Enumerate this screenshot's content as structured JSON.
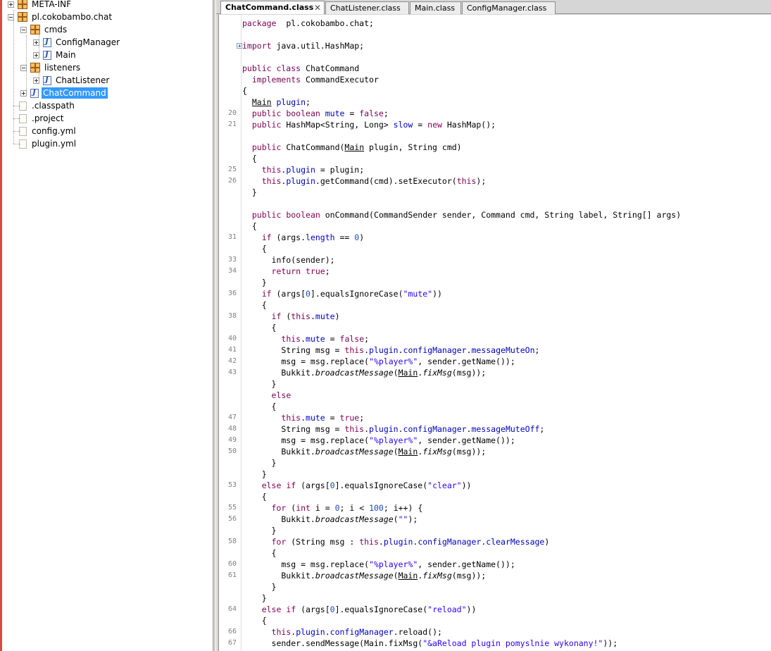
{
  "tree": {
    "items": [
      {
        "label": "META-INF",
        "icon": "package-icon",
        "depth": 0,
        "expander": "plus"
      },
      {
        "label": "pl.cokobambo.chat",
        "icon": "package-icon",
        "depth": 0,
        "expander": "minus"
      },
      {
        "label": "cmds",
        "icon": "package-icon",
        "depth": 1,
        "expander": "minus"
      },
      {
        "label": "ConfigManager",
        "icon": "class-icon",
        "depth": 2,
        "expander": "plus"
      },
      {
        "label": "Main",
        "icon": "class-icon",
        "depth": 2,
        "expander": "plus"
      },
      {
        "label": "listeners",
        "icon": "package-icon",
        "depth": 1,
        "expander": "minus"
      },
      {
        "label": "ChatListener",
        "icon": "class-icon",
        "depth": 2,
        "expander": "plus"
      },
      {
        "label": "ChatCommand",
        "icon": "class-icon",
        "depth": 1,
        "expander": "plus",
        "selected": true
      },
      {
        "label": ".classpath",
        "icon": "file-icon",
        "depth": 0,
        "expander": "none"
      },
      {
        "label": ".project",
        "icon": "file-icon",
        "depth": 0,
        "expander": "none"
      },
      {
        "label": "config.yml",
        "icon": "file-icon",
        "depth": 0,
        "expander": "none"
      },
      {
        "label": "plugin.yml",
        "icon": "file-icon",
        "depth": 0,
        "expander": "none"
      }
    ]
  },
  "tabs": [
    {
      "label": "ChatCommand.class",
      "active": true,
      "close": "✕"
    },
    {
      "label": "ChatListener.class",
      "active": false
    },
    {
      "label": "Main.class",
      "active": false
    },
    {
      "label": "ConfigManager.class",
      "active": false
    }
  ],
  "code": [
    {
      "ln": "",
      "tokens": [
        [
          "kw",
          "package"
        ],
        [
          "",
          "  pl.cokobambo.chat;"
        ]
      ]
    },
    {
      "ln": "",
      "tokens": []
    },
    {
      "ln": "",
      "fold": true,
      "tokens": [
        [
          "kw",
          "import"
        ],
        [
          "",
          " java.util.HashMap;"
        ]
      ]
    },
    {
      "ln": "",
      "tokens": []
    },
    {
      "ln": "",
      "tokens": [
        [
          "kw",
          "public class"
        ],
        [
          "",
          " ChatCommand"
        ]
      ]
    },
    {
      "ln": "",
      "tokens": [
        [
          "",
          "  "
        ],
        [
          "kw",
          "implements"
        ],
        [
          "",
          " CommandExecutor"
        ]
      ]
    },
    {
      "ln": "",
      "tokens": [
        [
          "",
          "{"
        ]
      ]
    },
    {
      "ln": "",
      "tokens": [
        [
          "",
          "  "
        ],
        [
          "und",
          "Main"
        ],
        [
          "",
          " "
        ],
        [
          "fld",
          "plugin"
        ],
        [
          "",
          ";"
        ]
      ]
    },
    {
      "ln": "20",
      "tokens": [
        [
          "",
          "  "
        ],
        [
          "kw",
          "public boolean"
        ],
        [
          "",
          " "
        ],
        [
          "fld",
          "mute"
        ],
        [
          "",
          " = "
        ],
        [
          "kw",
          "false"
        ],
        [
          "",
          ";"
        ]
      ]
    },
    {
      "ln": "21",
      "tokens": [
        [
          "",
          "  "
        ],
        [
          "kw",
          "public"
        ],
        [
          "",
          " HashMap<String, Long> "
        ],
        [
          "fld",
          "slow"
        ],
        [
          "",
          " = "
        ],
        [
          "kw",
          "new"
        ],
        [
          "",
          " HashMap();"
        ]
      ]
    },
    {
      "ln": "",
      "tokens": []
    },
    {
      "ln": "",
      "tokens": [
        [
          "",
          "  "
        ],
        [
          "kw",
          "public"
        ],
        [
          "",
          " ChatCommand("
        ],
        [
          "und",
          "Main"
        ],
        [
          "",
          " plugin, String cmd)"
        ]
      ]
    },
    {
      "ln": "",
      "tokens": [
        [
          "",
          "  {"
        ]
      ]
    },
    {
      "ln": "25",
      "tokens": [
        [
          "",
          "    "
        ],
        [
          "kw",
          "this"
        ],
        [
          "",
          "."
        ],
        [
          "fld",
          "plugin"
        ],
        [
          "",
          " = plugin;"
        ]
      ]
    },
    {
      "ln": "26",
      "tokens": [
        [
          "",
          "    "
        ],
        [
          "kw",
          "this"
        ],
        [
          "",
          "."
        ],
        [
          "fld",
          "plugin"
        ],
        [
          "",
          ".getCommand(cmd).setExecutor("
        ],
        [
          "kw",
          "this"
        ],
        [
          "",
          ");"
        ]
      ]
    },
    {
      "ln": "",
      "tokens": [
        [
          "",
          "  }"
        ]
      ]
    },
    {
      "ln": "",
      "tokens": []
    },
    {
      "ln": "",
      "tokens": [
        [
          "",
          "  "
        ],
        [
          "kw",
          "public boolean"
        ],
        [
          "",
          " onCommand(CommandSender sender, Command cmd, String label, String[] args)"
        ]
      ]
    },
    {
      "ln": "",
      "tokens": [
        [
          "",
          "  {"
        ]
      ]
    },
    {
      "ln": "31",
      "tokens": [
        [
          "",
          "    "
        ],
        [
          "kw",
          "if"
        ],
        [
          "",
          " (args."
        ],
        [
          "fld",
          "length"
        ],
        [
          "",
          " == "
        ],
        [
          "num",
          "0"
        ],
        [
          "",
          ")"
        ]
      ]
    },
    {
      "ln": "",
      "tokens": [
        [
          "",
          "    {"
        ]
      ]
    },
    {
      "ln": "33",
      "tokens": [
        [
          "",
          "      info(sender);"
        ]
      ]
    },
    {
      "ln": "34",
      "tokens": [
        [
          "",
          "      "
        ],
        [
          "kw",
          "return true"
        ],
        [
          "",
          ";"
        ]
      ]
    },
    {
      "ln": "",
      "tokens": [
        [
          "",
          "    }"
        ]
      ]
    },
    {
      "ln": "36",
      "tokens": [
        [
          "",
          "    "
        ],
        [
          "kw",
          "if"
        ],
        [
          "",
          " (args["
        ],
        [
          "num",
          "0"
        ],
        [
          "",
          "].equalsIgnoreCase("
        ],
        [
          "str",
          "\"mute\""
        ],
        [
          "",
          "))"
        ]
      ]
    },
    {
      "ln": "",
      "tokens": [
        [
          "",
          "    {"
        ]
      ]
    },
    {
      "ln": "38",
      "tokens": [
        [
          "",
          "      "
        ],
        [
          "kw",
          "if"
        ],
        [
          "",
          " ("
        ],
        [
          "kw",
          "this"
        ],
        [
          "",
          "."
        ],
        [
          "fld",
          "mute"
        ],
        [
          "",
          ")"
        ]
      ]
    },
    {
      "ln": "",
      "tokens": [
        [
          "",
          "      {"
        ]
      ]
    },
    {
      "ln": "40",
      "tokens": [
        [
          "",
          "        "
        ],
        [
          "kw",
          "this"
        ],
        [
          "",
          "."
        ],
        [
          "fld",
          "mute"
        ],
        [
          "",
          " = "
        ],
        [
          "kw",
          "false"
        ],
        [
          "",
          ";"
        ]
      ]
    },
    {
      "ln": "41",
      "tokens": [
        [
          "",
          "        String msg = "
        ],
        [
          "kw",
          "this"
        ],
        [
          "",
          "."
        ],
        [
          "fld",
          "plugin"
        ],
        [
          "",
          "."
        ],
        [
          "fld",
          "configManager"
        ],
        [
          "",
          "."
        ],
        [
          "fld",
          "messageMuteOn"
        ],
        [
          "",
          ";"
        ]
      ]
    },
    {
      "ln": "42",
      "tokens": [
        [
          "",
          "        msg = msg.replace("
        ],
        [
          "str",
          "\"%player%\""
        ],
        [
          "",
          ", sender.getName());"
        ]
      ]
    },
    {
      "ln": "43",
      "tokens": [
        [
          "",
          "        Bukkit."
        ],
        [
          "itl",
          "broadcastMessage"
        ],
        [
          "",
          "("
        ],
        [
          "und",
          "Main"
        ],
        [
          "",
          "."
        ],
        [
          "itl",
          "fixMsg"
        ],
        [
          "",
          "(msg));"
        ]
      ]
    },
    {
      "ln": "",
      "tokens": [
        [
          "",
          "      }"
        ]
      ]
    },
    {
      "ln": "",
      "tokens": [
        [
          "",
          "      "
        ],
        [
          "kw",
          "else"
        ]
      ]
    },
    {
      "ln": "",
      "tokens": [
        [
          "",
          "      {"
        ]
      ]
    },
    {
      "ln": "47",
      "tokens": [
        [
          "",
          "        "
        ],
        [
          "kw",
          "this"
        ],
        [
          "",
          "."
        ],
        [
          "fld",
          "mute"
        ],
        [
          "",
          " = "
        ],
        [
          "kw",
          "true"
        ],
        [
          "",
          ";"
        ]
      ]
    },
    {
      "ln": "48",
      "tokens": [
        [
          "",
          "        String msg = "
        ],
        [
          "kw",
          "this"
        ],
        [
          "",
          "."
        ],
        [
          "fld",
          "plugin"
        ],
        [
          "",
          "."
        ],
        [
          "fld",
          "configManager"
        ],
        [
          "",
          "."
        ],
        [
          "fld",
          "messageMuteOff"
        ],
        [
          "",
          ";"
        ]
      ]
    },
    {
      "ln": "49",
      "tokens": [
        [
          "",
          "        msg = msg.replace("
        ],
        [
          "str",
          "\"%player%\""
        ],
        [
          "",
          ", sender.getName());"
        ]
      ]
    },
    {
      "ln": "50",
      "tokens": [
        [
          "",
          "        Bukkit."
        ],
        [
          "itl",
          "broadcastMessage"
        ],
        [
          "",
          "("
        ],
        [
          "und",
          "Main"
        ],
        [
          "",
          "."
        ],
        [
          "itl",
          "fixMsg"
        ],
        [
          "",
          "(msg));"
        ]
      ]
    },
    {
      "ln": "",
      "tokens": [
        [
          "",
          "      }"
        ]
      ]
    },
    {
      "ln": "",
      "tokens": [
        [
          "",
          "    }"
        ]
      ]
    },
    {
      "ln": "53",
      "tokens": [
        [
          "",
          "    "
        ],
        [
          "kw",
          "else if"
        ],
        [
          "",
          " (args["
        ],
        [
          "num",
          "0"
        ],
        [
          "",
          "].equalsIgnoreCase("
        ],
        [
          "str",
          "\"clear\""
        ],
        [
          "",
          "))"
        ]
      ]
    },
    {
      "ln": "",
      "tokens": [
        [
          "",
          "    {"
        ]
      ]
    },
    {
      "ln": "55",
      "tokens": [
        [
          "",
          "      "
        ],
        [
          "kw",
          "for"
        ],
        [
          "",
          " ("
        ],
        [
          "kw",
          "int"
        ],
        [
          "",
          " i = "
        ],
        [
          "num",
          "0"
        ],
        [
          "",
          "; i < "
        ],
        [
          "num",
          "100"
        ],
        [
          "",
          "; i++) {"
        ]
      ]
    },
    {
      "ln": "56",
      "tokens": [
        [
          "",
          "        Bukkit."
        ],
        [
          "itl",
          "broadcastMessage"
        ],
        [
          "",
          "("
        ],
        [
          "str",
          "\"\""
        ],
        [
          "",
          ");"
        ]
      ]
    },
    {
      "ln": "",
      "tokens": [
        [
          "",
          "      }"
        ]
      ]
    },
    {
      "ln": "58",
      "tokens": [
        [
          "",
          "      "
        ],
        [
          "kw",
          "for"
        ],
        [
          "",
          " (String msg : "
        ],
        [
          "kw",
          "this"
        ],
        [
          "",
          "."
        ],
        [
          "fld",
          "plugin"
        ],
        [
          "",
          "."
        ],
        [
          "fld",
          "configManager"
        ],
        [
          "",
          "."
        ],
        [
          "fld",
          "clearMessage"
        ],
        [
          "",
          ")"
        ]
      ]
    },
    {
      "ln": "",
      "tokens": [
        [
          "",
          "      {"
        ]
      ]
    },
    {
      "ln": "60",
      "tokens": [
        [
          "",
          "        msg = msg.replace("
        ],
        [
          "str",
          "\"%player%\""
        ],
        [
          "",
          ", sender.getName());"
        ]
      ]
    },
    {
      "ln": "61",
      "tokens": [
        [
          "",
          "        Bukkit."
        ],
        [
          "itl",
          "broadcastMessage"
        ],
        [
          "",
          "("
        ],
        [
          "und",
          "Main"
        ],
        [
          "",
          "."
        ],
        [
          "itl",
          "fixMsg"
        ],
        [
          "",
          "(msg));"
        ]
      ]
    },
    {
      "ln": "",
      "tokens": [
        [
          "",
          "      }"
        ]
      ]
    },
    {
      "ln": "",
      "tokens": [
        [
          "",
          "    }"
        ]
      ]
    },
    {
      "ln": "64",
      "tokens": [
        [
          "",
          "    "
        ],
        [
          "kw",
          "else if"
        ],
        [
          "",
          " (args["
        ],
        [
          "num",
          "0"
        ],
        [
          "",
          "].equalsIgnoreCase("
        ],
        [
          "str",
          "\"reload\""
        ],
        [
          "",
          "))"
        ]
      ]
    },
    {
      "ln": "",
      "tokens": [
        [
          "",
          "    {"
        ]
      ]
    },
    {
      "ln": "66",
      "tokens": [
        [
          "",
          "      "
        ],
        [
          "kw",
          "this"
        ],
        [
          "",
          "."
        ],
        [
          "fld",
          "plugin"
        ],
        [
          "",
          "."
        ],
        [
          "fld",
          "configManager"
        ],
        [
          "",
          ".reload();"
        ]
      ]
    },
    {
      "ln": "67",
      "tokens": [
        [
          "",
          "      sender.sendMessage(Main.fixMsg("
        ],
        [
          "str",
          "\"&aReload plugin pomyslnie wykonany!\""
        ],
        [
          "",
          "));"
        ]
      ]
    }
  ]
}
